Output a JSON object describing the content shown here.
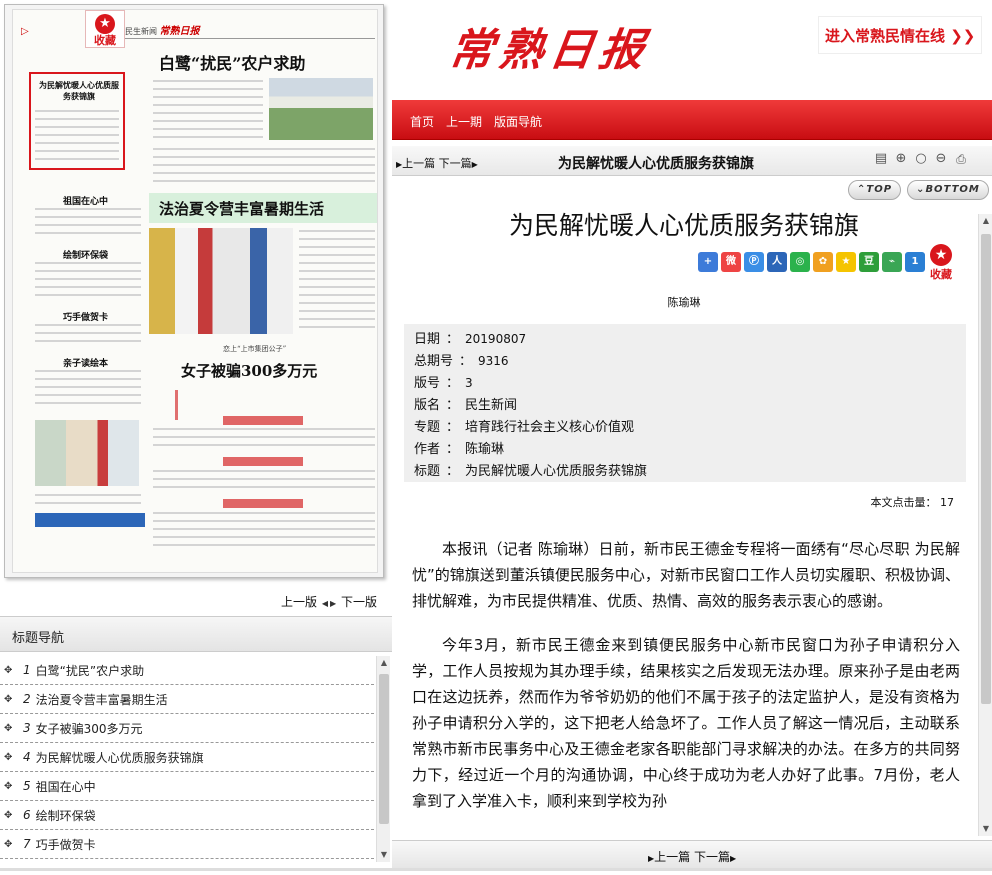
{
  "left": {
    "favorite_label": "收藏",
    "paper_masthead": "民生新闻",
    "paper_masthead_brand": "常熟日报",
    "paper_headlines": {
      "h1": "白鹭“扰民”农户求助",
      "h2": "法治夏令营丰富暑期生活",
      "h3": "女子被骗300多万元",
      "box": "为民解忧暖人心优质服务获锦旗",
      "s1": "祖国在心中",
      "s2": "绘制环保袋",
      "s3": "巧手做贺卡",
      "s4": "亲子读绘本",
      "kicker": "恋上“上市集团公子”"
    },
    "pager": {
      "prev": "上一版",
      "next": "下一版"
    },
    "nav_title": "标题导航",
    "nav_items": [
      {
        "num": "1",
        "title": "白鹭“扰民”农户求助"
      },
      {
        "num": "2",
        "title": "法治夏令营丰富暑期生活"
      },
      {
        "num": "3",
        "title": "女子被骗300多万元"
      },
      {
        "num": "4",
        "title": "为民解忧暖人心优质服务获锦旗"
      },
      {
        "num": "5",
        "title": "祖国在心中"
      },
      {
        "num": "6",
        "title": "绘制环保袋"
      },
      {
        "num": "7",
        "title": "巧手做贺卡"
      }
    ]
  },
  "header": {
    "brand": "常熟日报",
    "promo": "进入常熟民情在线 ❯❯",
    "nav": [
      "首页",
      "上一期",
      "版面导航"
    ]
  },
  "toolbar": {
    "prev": "上一篇",
    "next": "下一篇",
    "title": "为民解忧暖人心优质服务获锦旗",
    "top_btn": "TOP",
    "bottom_btn": "BOTTOM"
  },
  "article": {
    "title": "为民解忧暖人心优质服务获锦旗",
    "author": "陈瑜琳",
    "favorite_label": "收藏",
    "meta": {
      "date_k": "日期",
      "date_v": "20190807",
      "issue_k": "总期号",
      "issue_v": "9316",
      "page_k": "版号",
      "page_v": "3",
      "section_k": "版名",
      "section_v": "民生新闻",
      "topic_k": "专题",
      "topic_v": "培育践行社会主义核心价值观",
      "author_k": "作者",
      "author_v": "陈瑜琳",
      "headline_k": "标题",
      "headline_v": "为民解忧暖人心优质服务获锦旗"
    },
    "clicks_label": "本文点击量：",
    "clicks_value": "17",
    "p1": "本报讯（记者 陈瑜琳）日前，新市民王德金专程将一面绣有“尽心尽职 为民解忧”的锦旗送到董浜镇便民服务中心，对新市民窗口工作人员切实履职、积极协调、排忧解难，为市民提供精准、优质、热情、高效的服务表示衷心的感谢。",
    "p2": "今年3月，新市民王德金来到镇便民服务中心新市民窗口为孙子申请积分入学，工作人员按规为其办理手续，结果核实之后发现无法办理。原来孙子是由老两口在这边抚养，然而作为爷爷奶奶的他们不属于孩子的法定监护人，是没有资格为孙子申请积分入学的，这下把老人给急坏了。工作人员了解这一情况后，主动联系常熟市新市民事务中心及王德金老家各职能部门寻求解决的办法。在多方的共同努力下，经过近一个月的沟通协调，中心终于成功为老人办好了此事。7月份，老人拿到了入学准入卡，顺利来到学校为孙"
  },
  "bottom": {
    "prev": "上一篇",
    "next": "下一篇"
  },
  "colors": {
    "brand_red": "#d9161c",
    "nav_red": "#c80d12"
  }
}
